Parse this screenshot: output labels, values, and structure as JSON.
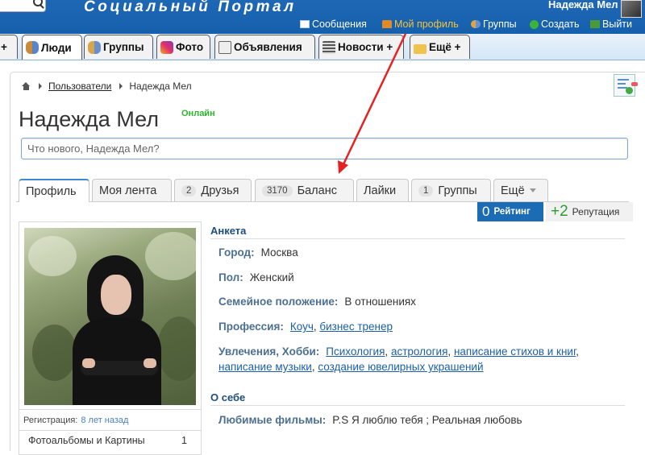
{
  "portal_title": "Социальный Портал",
  "header": {
    "user_name": "Надежда Мел",
    "links": [
      {
        "label": "Сообщения",
        "icon": "envelope-icon"
      },
      {
        "label": "Мой профиль",
        "icon": "home-profile-icon",
        "active": true
      },
      {
        "label": "Группы",
        "icon": "groups-icon"
      },
      {
        "label": "Создать",
        "icon": "plus-icon"
      },
      {
        "label": "Выйти",
        "icon": "exit-icon"
      }
    ]
  },
  "mainnav": {
    "items": [
      {
        "label": "+"
      },
      {
        "label": "Люди",
        "icon": "people-icon"
      },
      {
        "label": "Группы",
        "icon": "groups-icon"
      },
      {
        "label": "Фото",
        "icon": "photo-icon"
      },
      {
        "label": "Объявления",
        "icon": "ads-icon"
      },
      {
        "label": "Новости +",
        "icon": "news-icon"
      },
      {
        "label": "Ещё +",
        "icon": "more-icon"
      }
    ]
  },
  "breadcrumb": {
    "link": "Пользователи",
    "current": "Надежда Мел"
  },
  "profile": {
    "name": "Надежда Мел",
    "online": "Онлайн",
    "status_placeholder": "Что нового, Надежда Мел?"
  },
  "tabs": [
    {
      "label": "Профиль",
      "active": true
    },
    {
      "label": "Моя лента"
    },
    {
      "label": "Друзья",
      "count": "2"
    },
    {
      "label": "Баланс",
      "count": "3170"
    },
    {
      "label": "Лайки"
    },
    {
      "label": "Группы",
      "count": "1"
    },
    {
      "label": "Ещё"
    }
  ],
  "stats": {
    "rating_value": "0",
    "rating_label": "Рейтинг",
    "reputation_value": "+2",
    "reputation_label": "Репутация"
  },
  "sidebar": {
    "registration_label": "Регистрация:",
    "registration_value": "8 лет назад",
    "albums_label": "Фотоальбомы и Картины",
    "albums_count": "1"
  },
  "anketa": {
    "title": "Анкета",
    "city_label": "Город:",
    "city": "Москва",
    "gender_label": "Пол:",
    "gender": "Женский",
    "family_label": "Семейное положение:",
    "family": "В отношениях",
    "profession_label": "Профессия:",
    "professions": [
      "Коуч",
      "бизнес тренер"
    ],
    "hobby_label": "Увлечения, Хобби:",
    "hobbies": [
      "Психология",
      "астрология",
      "написание стихов и книг",
      "написание музыки",
      "создание ювелирных украшений"
    ]
  },
  "about": {
    "title": "О себе",
    "films_label": "Любимые фильмы:",
    "films": "P.S Я люблю тебя ; Реальная любовь"
  },
  "colors": {
    "header": "#1560ac",
    "accent": "#3e8ad0",
    "link": "#1c5fa9",
    "rating": "#1b6bb5",
    "reputation": "#2f9a2f",
    "arrow": "#e52222"
  }
}
